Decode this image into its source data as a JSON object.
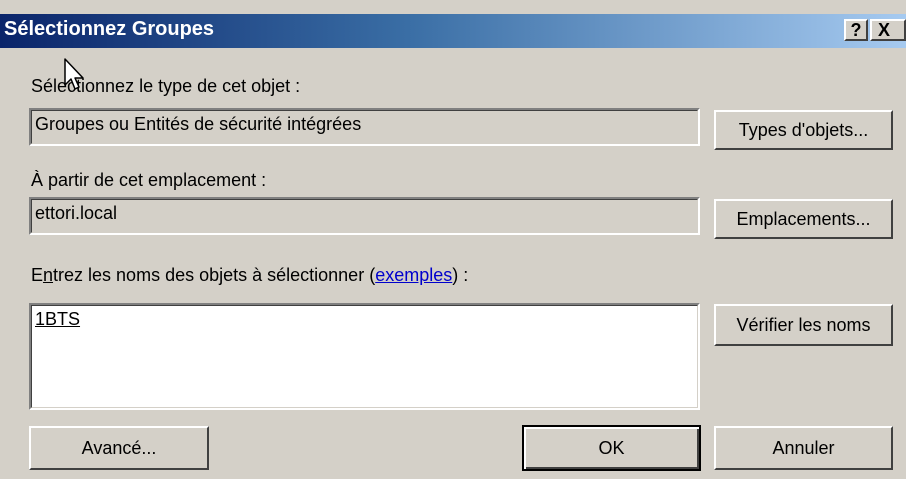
{
  "window": {
    "title": "Sélectionnez Groupes",
    "help_glyph": "?",
    "close_glyph": "X"
  },
  "object_type": {
    "label": "Sélectionnez le type de cet objet :",
    "value": "Groupes ou Entités de sécurité intégrées",
    "button": "Types d'objets..."
  },
  "location": {
    "label": "À partir de cet emplacement :",
    "value": "ettori.local",
    "button": "Emplacements..."
  },
  "names": {
    "label_prefix": "E",
    "label_accel": "n",
    "label_rest": "trez les noms des objets à sélectionner (",
    "link": "exemples",
    "label_suffix": ") :",
    "value": "1BTS",
    "button": "Vérifier les noms"
  },
  "footer": {
    "advanced_button": "Avancé...",
    "ok_button": "OK",
    "cancel_button": "Annuler"
  },
  "icons": {
    "cursor": "mouse-pointer-icon"
  },
  "colors": {
    "title_start": "#0a246a",
    "title_end": "#a6caf0",
    "dialog_bg": "#d4d0c8",
    "link": "#0000cc"
  }
}
